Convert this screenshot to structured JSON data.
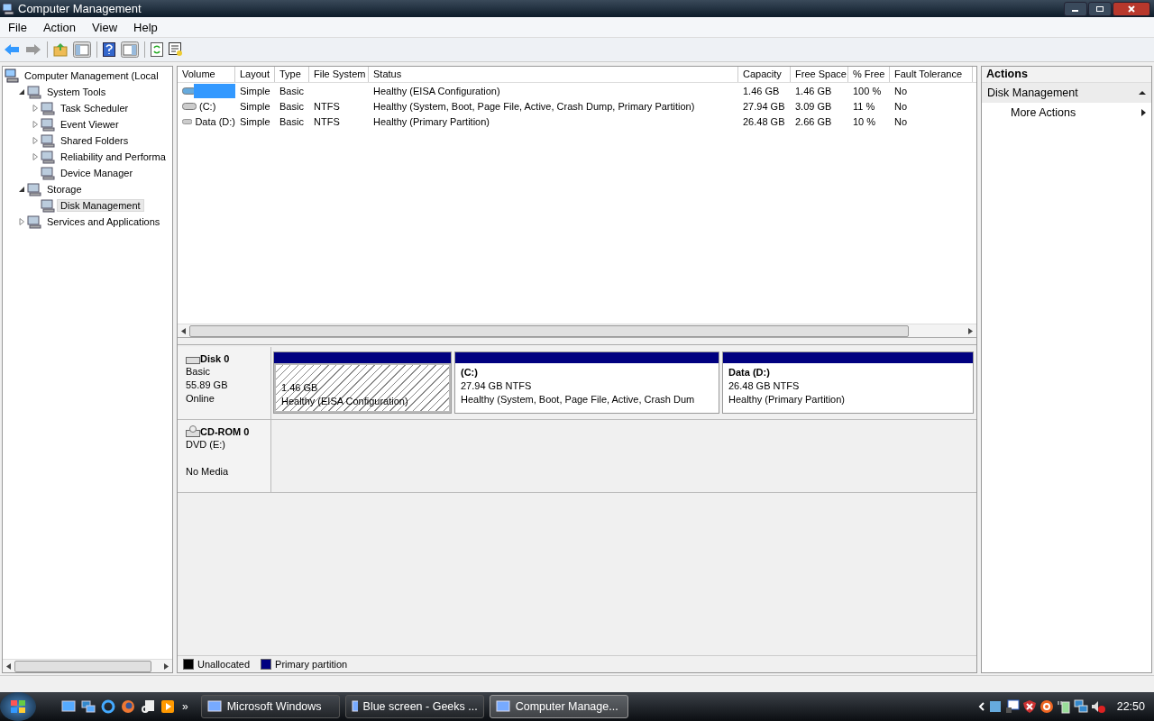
{
  "window": {
    "title": "Computer Management"
  },
  "menu": [
    "File",
    "Action",
    "View",
    "Help"
  ],
  "tree": [
    {
      "label": "Computer Management (Local",
      "kind": "root",
      "selected": false,
      "children": [
        {
          "label": "System Tools",
          "kind": "branch",
          "expanded": true,
          "selected": false,
          "children": [
            {
              "label": "Task Scheduler",
              "kind": "branch",
              "expanded": false,
              "selected": false
            },
            {
              "label": "Event Viewer",
              "kind": "branch",
              "expanded": false,
              "selected": false
            },
            {
              "label": "Shared Folders",
              "kind": "branch",
              "expanded": false,
              "selected": false
            },
            {
              "label": "Reliability and Performa",
              "kind": "branch",
              "expanded": false,
              "selected": false
            },
            {
              "label": "Device Manager",
              "kind": "leaf",
              "selected": false
            }
          ]
        },
        {
          "label": "Storage",
          "kind": "branch",
          "expanded": true,
          "selected": false,
          "children": [
            {
              "label": "Disk Management",
              "kind": "leaf",
              "selected": true
            }
          ]
        },
        {
          "label": "Services and Applications",
          "kind": "branch",
          "expanded": false,
          "selected": false
        }
      ]
    }
  ],
  "volumes": {
    "columns": [
      "Volume",
      "Layout",
      "Type",
      "File System",
      "Status",
      "Capacity",
      "Free Space",
      "% Free",
      "Fault Tolerance"
    ],
    "rows": [
      {
        "redacted": true,
        "cells": [
          "",
          "Simple",
          "Basic",
          "",
          "Healthy (EISA Configuration)",
          "1.46 GB",
          "1.46 GB",
          "100 %",
          "No"
        ]
      },
      {
        "redacted": false,
        "cells": [
          "(C:)",
          "Simple",
          "Basic",
          "NTFS",
          "Healthy (System, Boot, Page File, Active, Crash Dump, Primary Partition)",
          "27.94 GB",
          "3.09 GB",
          "11 %",
          "No"
        ]
      },
      {
        "redacted": false,
        "cells": [
          "Data (D:)",
          "Simple",
          "Basic",
          "NTFS",
          "Healthy (Primary Partition)",
          "26.48 GB",
          "2.66 GB",
          "10 %",
          "No"
        ]
      }
    ]
  },
  "disks": [
    {
      "name": "Disk 0",
      "kind": "disk",
      "lines": [
        "Basic",
        "55.89 GB",
        "Online"
      ],
      "partitions": [
        {
          "kind": "hatched",
          "size": "1.46 GB",
          "status": "Healthy (EISA Configuration)"
        },
        {
          "kind": "primary",
          "title": "(C:)",
          "size": "27.94 GB NTFS",
          "status": "Healthy (System, Boot, Page File, Active, Crash Dum"
        },
        {
          "kind": "primary",
          "title": "Data  (D:)",
          "size": "26.48 GB NTFS",
          "status": "Healthy (Primary Partition)"
        }
      ]
    },
    {
      "name": "CD-ROM 0",
      "kind": "cdrom",
      "lines": [
        "DVD (E:)"
      ],
      "media": "No Media"
    }
  ],
  "legend": [
    {
      "label": "Unallocated",
      "color": "#000000"
    },
    {
      "label": "Primary partition",
      "color": "#000080"
    }
  ],
  "actions": {
    "title": "Actions",
    "section": {
      "label": "Disk Management",
      "expanded": true
    },
    "items": [
      "More Actions"
    ]
  },
  "taskbar": {
    "more": "»",
    "tasks": [
      {
        "label": "Microsoft Windows",
        "selected": false
      },
      {
        "label": "Blue screen - Geeks ...",
        "selected": false
      },
      {
        "label": "Computer Manage...",
        "selected": true
      }
    ],
    "clock": "22:50"
  }
}
